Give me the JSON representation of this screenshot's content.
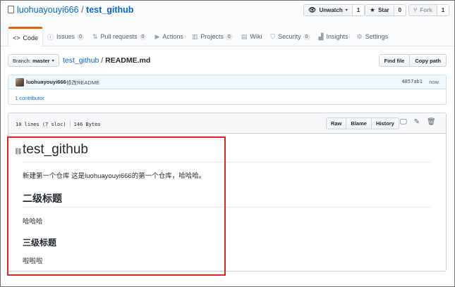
{
  "repo": {
    "owner": "luohuayouyi666",
    "separator": "/",
    "name": "test_github"
  },
  "actions": {
    "watch": {
      "label": "Unwatch",
      "count": "1"
    },
    "star": {
      "label": "Star",
      "count": "0"
    },
    "fork": {
      "label": "Fork",
      "count": "1"
    }
  },
  "tabs": [
    {
      "label": "Code",
      "count": ""
    },
    {
      "label": "Issues",
      "count": "0"
    },
    {
      "label": "Pull requests",
      "count": "0"
    },
    {
      "label": "Actions",
      "count": ""
    },
    {
      "label": "Projects",
      "count": "0"
    },
    {
      "label": "Wiki",
      "count": ""
    },
    {
      "label": "Security",
      "count": "0"
    },
    {
      "label": "Insights",
      "count": ""
    },
    {
      "label": "Settings",
      "count": ""
    }
  ],
  "branch": {
    "label": "Branch:",
    "value": "master"
  },
  "breadcrumb": {
    "repo": "test_github",
    "separator": "/",
    "file": "README.md"
  },
  "file_actions": {
    "find": "Find file",
    "copy": "Copy path"
  },
  "commit": {
    "author": "luohuayouyi666",
    "message": "修改README",
    "sha": "4857ab1",
    "time": "now",
    "contributors": "1 contributor"
  },
  "file": {
    "lines": "10 lines (7 sloc)",
    "size": "146 Bytes",
    "raw": "Raw",
    "blame": "Blame",
    "history": "History"
  },
  "readme": {
    "h1": "test_github",
    "p1": "新建第一个仓库 这是luohuayouyi666的第一个仓库，哈哈哈。",
    "h2": "二级标题",
    "p2": "哈哈哈",
    "h3": "三级标题",
    "p3": "啦啦啦"
  },
  "colors": {
    "accent": "#e36209",
    "link": "#0366d6",
    "highlight": "#e02424"
  }
}
